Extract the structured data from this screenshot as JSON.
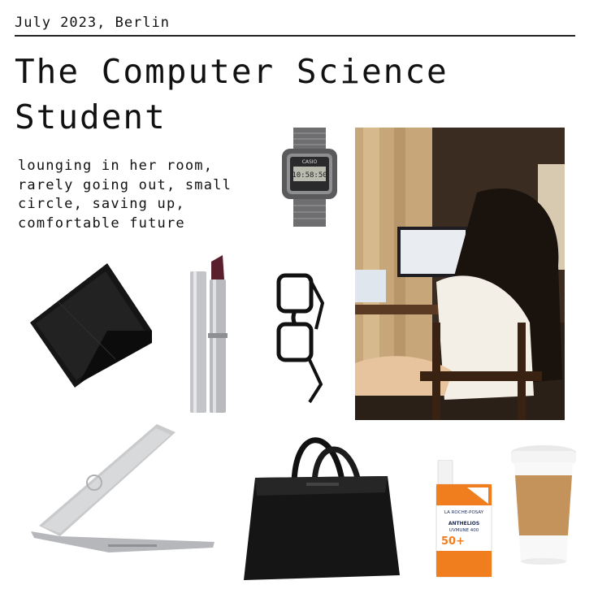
{
  "header": {
    "dateline": "July 2023, Berlin",
    "title_line1": "The Computer Science",
    "title_line2": "Student",
    "tagline_lines": [
      "lounging in her room,",
      "rarely going out, small",
      "circle, saving up,",
      "comfortable future"
    ]
  },
  "items": {
    "watch": {
      "screen_text": "10:58:50",
      "brand": "CASIO"
    },
    "sunscreen": {
      "brand": "LA ROCHE-POSAY",
      "line": "ANTHELIOS",
      "sub": "UVMUNE 400",
      "spf": "50+"
    }
  },
  "colors": {
    "accent_orange": "#f07d1e",
    "coffee_sleeve": "#c4935c",
    "laptop_silver": "#c9cacc",
    "leather_black": "#151515"
  }
}
